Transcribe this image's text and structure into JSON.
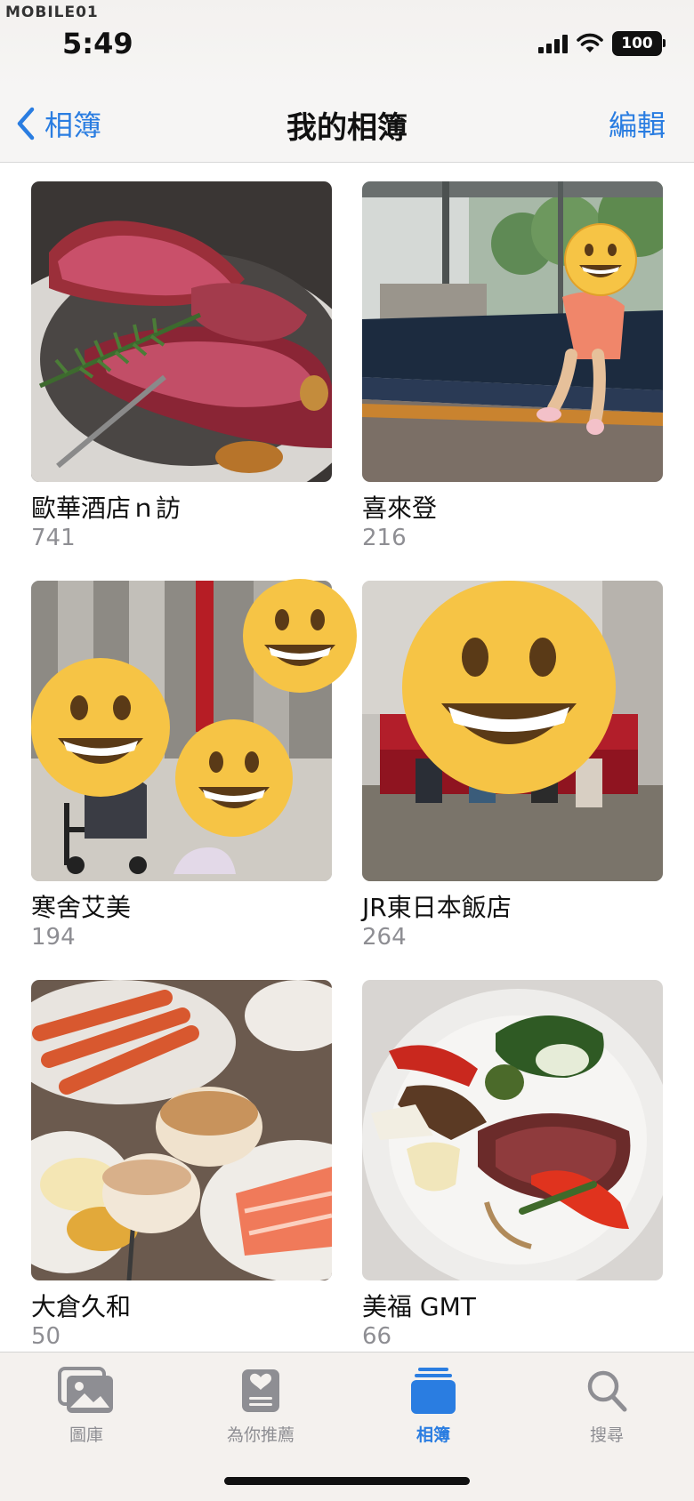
{
  "status": {
    "watermark": "MOBILE01",
    "time": "5:49",
    "battery": "100"
  },
  "nav": {
    "back_label": "相簿",
    "title": "我的相簿",
    "edit_label": "編輯"
  },
  "albums": [
    {
      "title": "歐華酒店ｎ訪",
      "count": "741"
    },
    {
      "title": "喜來登",
      "count": "216"
    },
    {
      "title": "寒舍艾美",
      "count": "194"
    },
    {
      "title": "JR東日本飯店",
      "count": "264"
    },
    {
      "title": "大倉久和",
      "count": "50"
    },
    {
      "title": "美福 GMT",
      "count": "66"
    }
  ],
  "tabs": [
    {
      "label": "圖庫",
      "icon": "photo-library-icon"
    },
    {
      "label": "為你推薦",
      "icon": "for-you-icon"
    },
    {
      "label": "相簿",
      "icon": "albums-icon",
      "active": true
    },
    {
      "label": "搜尋",
      "icon": "search-icon"
    }
  ],
  "colors": {
    "accent": "#2a7de1",
    "secondary_text": "#8e8e93"
  }
}
